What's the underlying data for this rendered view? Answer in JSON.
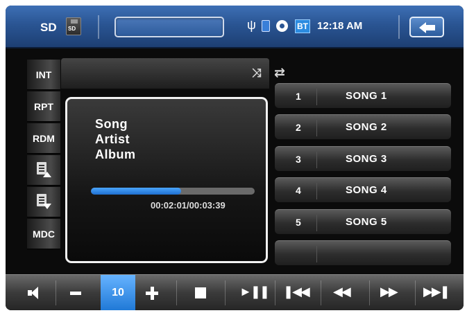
{
  "header": {
    "source_label": "SD",
    "sd_icon_label": "SD",
    "title_field_value": "",
    "bt_label": "BT",
    "clock": "12:18 AM",
    "icons": [
      "sd-card-icon",
      "usb-icon",
      "memory-card-icon",
      "disc-icon",
      "bluetooth-icon",
      "back-arrow-icon"
    ]
  },
  "sidebar": {
    "items": [
      {
        "label": "INT"
      },
      {
        "label": "RPT"
      },
      {
        "label": "RDM"
      },
      {
        "label": "",
        "icon": "playlist-up-icon"
      },
      {
        "label": "",
        "icon": "playlist-down-icon"
      },
      {
        "label": "MDC"
      }
    ]
  },
  "player": {
    "song": "Song",
    "artist": "Artist",
    "album": "Album",
    "time": "00:02:01/00:03:39",
    "progress_fraction": 0.55,
    "mode_icons": [
      "shuffle-icon",
      "repeat-icon"
    ]
  },
  "playlist": [
    {
      "num": "1",
      "title": "SONG 1"
    },
    {
      "num": "2",
      "title": "SONG 2"
    },
    {
      "num": "3",
      "title": "SONG 3"
    },
    {
      "num": "4",
      "title": "SONG 4"
    },
    {
      "num": "5",
      "title": "SONG 5"
    },
    {
      "num": "",
      "title": ""
    }
  ],
  "controls": {
    "volume": "10",
    "icons": [
      "mute-icon",
      "volume-down-icon",
      "volume-up-icon",
      "stop-icon",
      "play-pause-icon",
      "previous-track-icon",
      "rewind-icon",
      "fast-forward-icon",
      "next-track-icon"
    ]
  },
  "colors": {
    "header_blue": "#2a5593",
    "accent_blue": "#1f78d6"
  }
}
